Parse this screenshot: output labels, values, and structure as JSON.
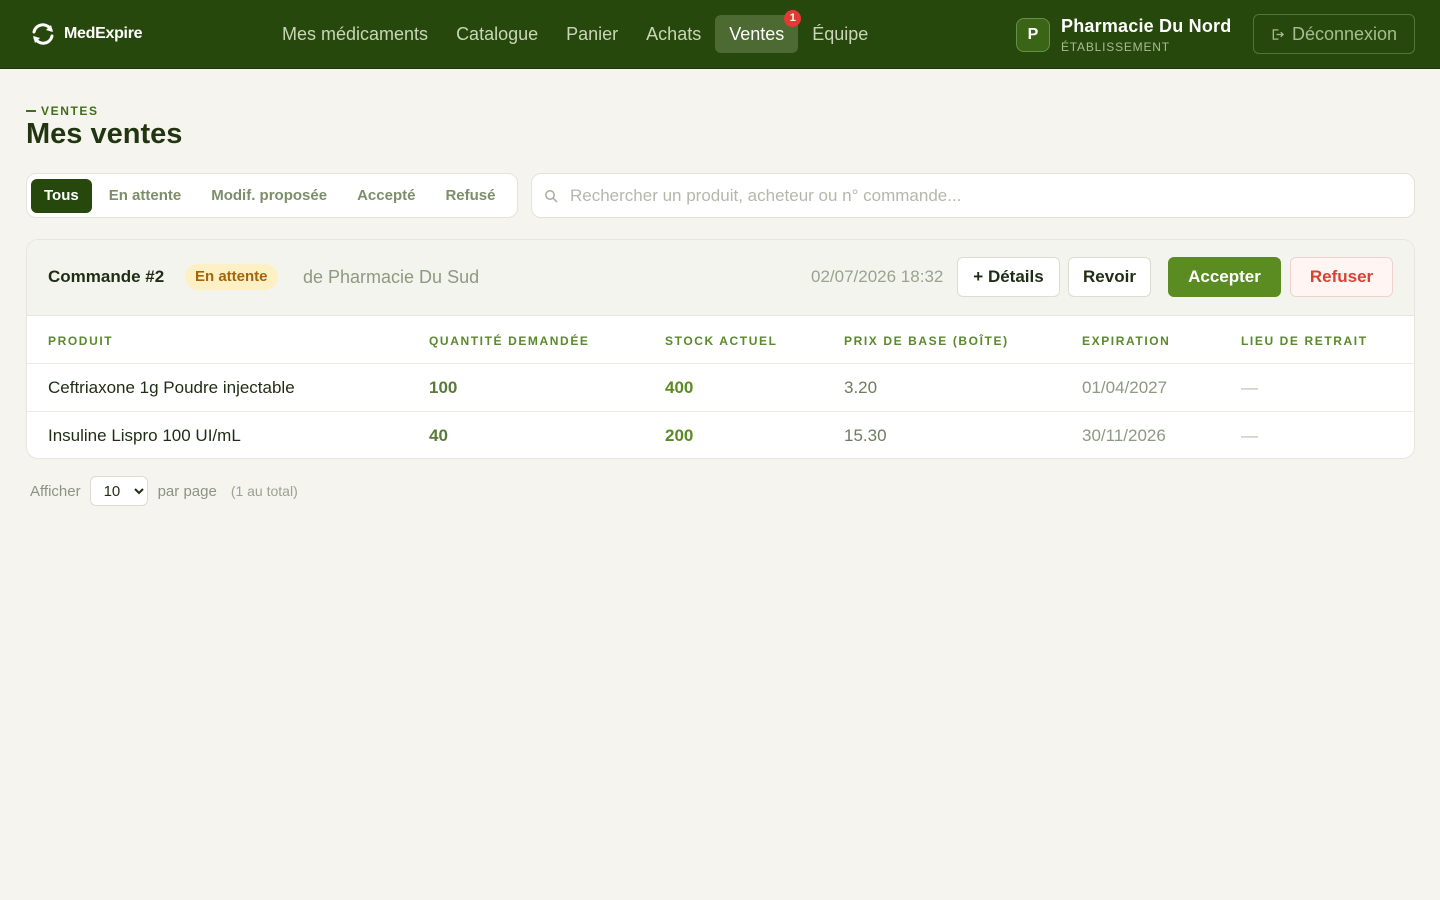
{
  "brand": {
    "name": "MedExpire"
  },
  "nav": {
    "items": [
      {
        "label": "Mes médicaments"
      },
      {
        "label": "Catalogue"
      },
      {
        "label": "Panier"
      },
      {
        "label": "Achats"
      },
      {
        "label": "Ventes",
        "badge": "1"
      },
      {
        "label": "Équipe"
      }
    ]
  },
  "account": {
    "initial": "P",
    "name": "Pharmacie Du Nord",
    "role": "ÉTABLISSEMENT",
    "logout_label": "Déconnexion"
  },
  "page": {
    "eyebrow": "VENTES",
    "title": "Mes ventes"
  },
  "filters": {
    "tabs": [
      {
        "label": "Tous"
      },
      {
        "label": "En attente"
      },
      {
        "label": "Modif. proposée"
      },
      {
        "label": "Accepté"
      },
      {
        "label": "Refusé"
      }
    ],
    "active": "Tous"
  },
  "search": {
    "placeholder": "Rechercher un produit, acheteur ou n° commande...",
    "value": ""
  },
  "order": {
    "title": "Commande #2",
    "status": "En attente",
    "buyer": "de Pharmacie Du Sud",
    "date": "02/07/2026 18:32",
    "actions": {
      "details": "+ Détails",
      "review": "Revoir",
      "accept": "Accepter",
      "refuse": "Refuser"
    },
    "columns": [
      "PRODUIT",
      "QUANTITÉ DEMANDÉE",
      "STOCK ACTUEL",
      "PRIX DE BASE (BOÎTE)",
      "EXPIRATION",
      "LIEU DE RETRAIT"
    ],
    "rows": [
      {
        "product": "Ceftriaxone 1g Poudre injectable",
        "qty": "100",
        "stock": "400",
        "price": "3.20",
        "expiration": "01/04/2027",
        "location": "—"
      },
      {
        "product": "Insuline Lispro 100 UI/mL",
        "qty": "40",
        "stock": "200",
        "price": "15.30",
        "expiration": "30/11/2026",
        "location": "—"
      }
    ]
  },
  "pagination": {
    "show_label": "Afficher",
    "per_page_value": "10",
    "per_page_label": "par page",
    "total": "(1 au total)"
  },
  "colors": {
    "header": "#27480c",
    "accent": "#5a8c22",
    "pending_bg": "#fdf0c4",
    "danger": "#d64334"
  }
}
